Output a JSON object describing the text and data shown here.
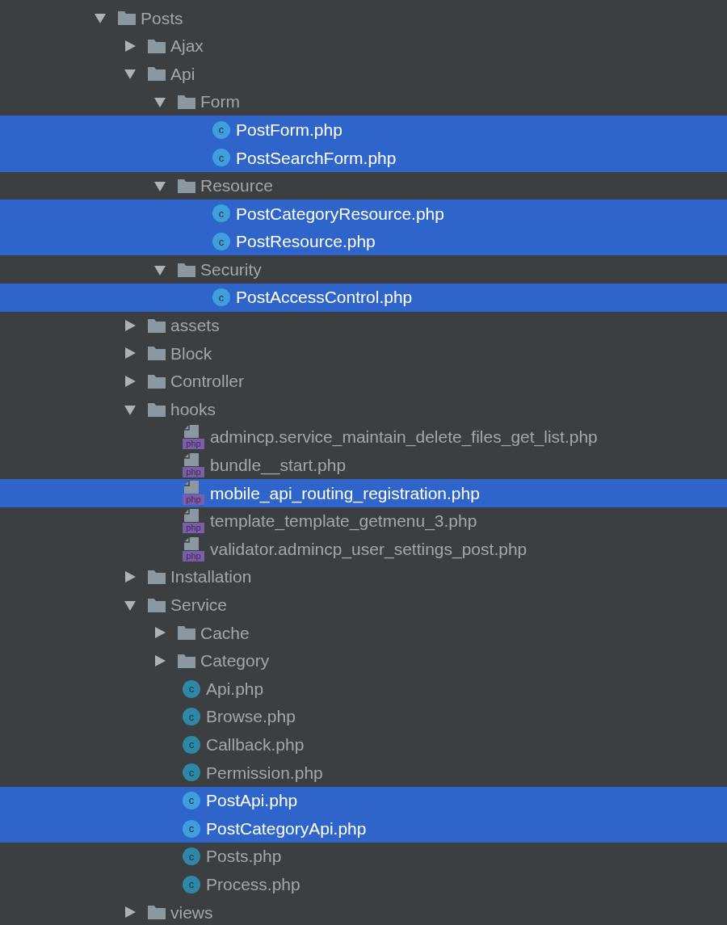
{
  "tree": [
    {
      "kind": "folder",
      "name": "Posts",
      "expanded": true,
      "children": [
        {
          "kind": "folder",
          "name": "Ajax",
          "expanded": false
        },
        {
          "kind": "folder",
          "name": "Api",
          "expanded": true,
          "children": [
            {
              "kind": "folder",
              "name": "Form",
              "expanded": true,
              "children": [
                {
                  "kind": "class",
                  "badge": "c",
                  "name": "PostForm.php",
                  "selected": true
                },
                {
                  "kind": "class",
                  "badge": "c",
                  "name": "PostSearchForm.php",
                  "selected": true
                }
              ]
            },
            {
              "kind": "folder",
              "name": "Resource",
              "expanded": true,
              "children": [
                {
                  "kind": "class",
                  "badge": "c",
                  "name": "PostCategoryResource.php",
                  "selected": true
                },
                {
                  "kind": "class",
                  "badge": "c",
                  "name": "PostResource.php",
                  "selected": true
                }
              ]
            },
            {
              "kind": "folder",
              "name": "Security",
              "expanded": true,
              "children": [
                {
                  "kind": "class",
                  "badge": "c",
                  "name": "PostAccessControl.php",
                  "selected": true
                }
              ]
            }
          ]
        },
        {
          "kind": "folder",
          "name": "assets",
          "expanded": false
        },
        {
          "kind": "folder",
          "name": "Block",
          "expanded": false
        },
        {
          "kind": "folder",
          "name": "Controller",
          "expanded": false
        },
        {
          "kind": "folder",
          "name": "hooks",
          "expanded": true,
          "children": [
            {
              "kind": "php",
              "badge": "php",
              "name": "admincp.service_maintain_delete_files_get_list.php",
              "selected": false
            },
            {
              "kind": "php",
              "badge": "php",
              "name": "bundle__start.php",
              "selected": false
            },
            {
              "kind": "php",
              "badge": "php",
              "name": "mobile_api_routing_registration.php",
              "selected": true
            },
            {
              "kind": "php",
              "badge": "php",
              "name": "template_template_getmenu_3.php",
              "selected": false
            },
            {
              "kind": "php",
              "badge": "php",
              "name": "validator.admincp_user_settings_post.php",
              "selected": false
            }
          ]
        },
        {
          "kind": "folder",
          "name": "Installation",
          "expanded": false
        },
        {
          "kind": "folder",
          "name": "Service",
          "expanded": true,
          "children": [
            {
              "kind": "folder",
              "name": "Cache",
              "expanded": false
            },
            {
              "kind": "folder",
              "name": "Category",
              "expanded": false
            },
            {
              "kind": "class",
              "badge": "c",
              "name": "Api.php",
              "selected": false
            },
            {
              "kind": "class",
              "badge": "c",
              "name": "Browse.php",
              "selected": false
            },
            {
              "kind": "class",
              "badge": "c",
              "name": "Callback.php",
              "selected": false
            },
            {
              "kind": "class",
              "badge": "c",
              "name": "Permission.php",
              "selected": false
            },
            {
              "kind": "class",
              "badge": "c",
              "name": "PostApi.php",
              "selected": true
            },
            {
              "kind": "class",
              "badge": "c",
              "name": "PostCategoryApi.php",
              "selected": true
            },
            {
              "kind": "class",
              "badge": "c",
              "name": "Posts.php",
              "selected": false
            },
            {
              "kind": "class",
              "badge": "c",
              "name": "Process.php",
              "selected": false
            }
          ]
        },
        {
          "kind": "folder",
          "name": "views",
          "expanded": false
        }
      ]
    }
  ]
}
